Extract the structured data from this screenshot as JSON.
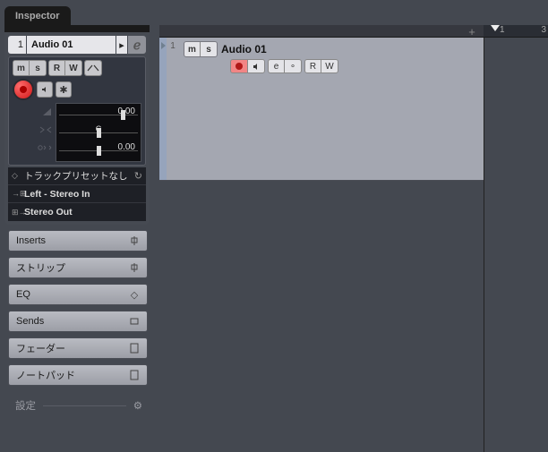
{
  "inspector": {
    "tab_label": "Inspector",
    "track": {
      "index": "1",
      "name": "Audio 01"
    },
    "buttons": {
      "mute": "m",
      "solo": "s",
      "read": "R",
      "write": "W"
    },
    "faders": {
      "volume": {
        "value": "0.00",
        "pos": 85
      },
      "pan": {
        "value": "C",
        "pos": 50
      },
      "delay": {
        "value": "0.00",
        "pos": 50
      }
    },
    "preset": {
      "label": "トラックプリセットなし"
    },
    "io": {
      "input": "Left - Stereo In",
      "output": "Stereo Out"
    },
    "sections": {
      "inserts": "Inserts",
      "strip": "ストリップ",
      "eq": "EQ",
      "sends": "Sends",
      "fader": "フェーダー",
      "notepad": "ノートパッド"
    },
    "settings": "設定"
  },
  "track_list": {
    "track": {
      "index": "1",
      "name": "Audio 01",
      "mute": "m",
      "solo": "s",
      "read": "R",
      "write": "W",
      "edit": "e"
    }
  },
  "timeline": {
    "pos1": "1",
    "pos3": "3"
  }
}
